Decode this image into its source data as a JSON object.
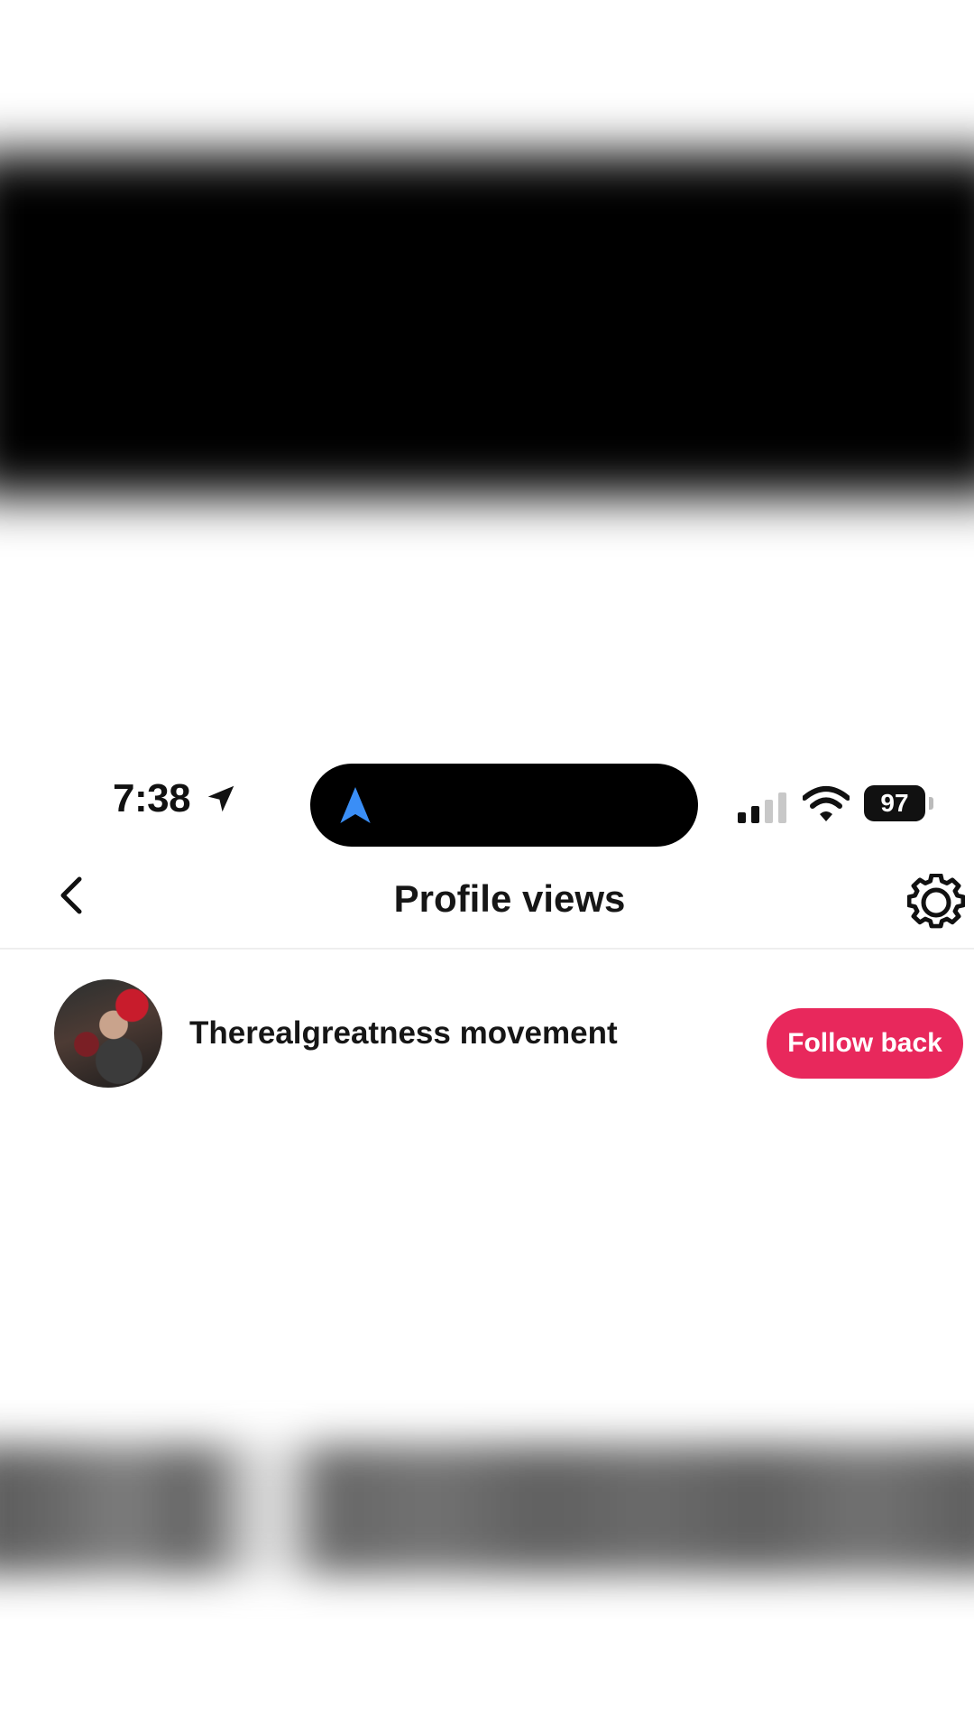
{
  "status_bar": {
    "time": "7:38",
    "battery_level": "97"
  },
  "header": {
    "title": "Profile views"
  },
  "viewers": [
    {
      "name": "Therealgreatness movement",
      "action_label": "Follow back"
    }
  ],
  "colors": {
    "accent": "#e8285c",
    "island_arrow": "#3a8ef6",
    "text_primary": "#161616"
  },
  "icons": {
    "location": "location-arrow-icon",
    "navigation": "navigation-arrow-icon",
    "signal": "cellular-signal-icon",
    "wifi": "wifi-icon",
    "battery": "battery-icon",
    "back": "chevron-left-icon",
    "settings": "gear-icon"
  }
}
